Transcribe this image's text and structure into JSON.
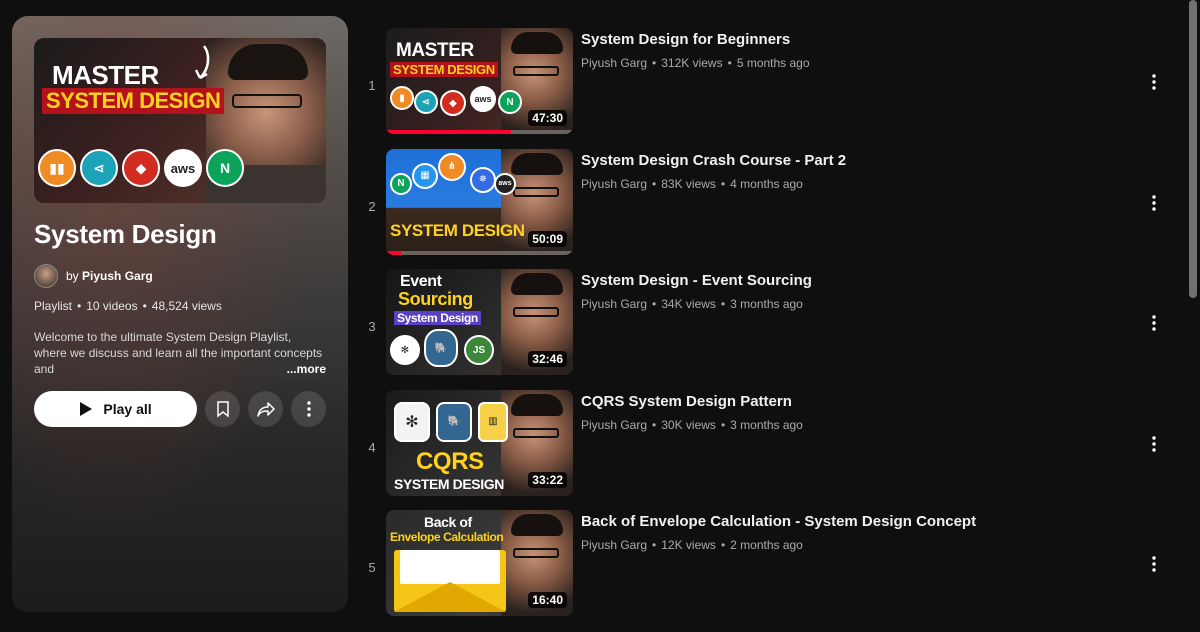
{
  "playlist": {
    "title": "System Design",
    "owner_prefix": "by",
    "owner_name": "Piyush Garg",
    "type_label": "Playlist",
    "video_count": "10 videos",
    "views": "48,524 views",
    "description": "Welcome to the ultimate System Design Playlist, where we discuss and learn all the important concepts and",
    "more_label": "...more",
    "play_all_label": "Play all",
    "hero_thumb": {
      "line1": "MASTER",
      "line2": "SYSTEM DESIGN",
      "logos": [
        "aws",
        "N"
      ]
    }
  },
  "videos": [
    {
      "index": "1",
      "title": "System Design for Beginners",
      "channel": "Piyush Garg",
      "views": "312K views",
      "age": "5 months ago",
      "duration": "47:30",
      "progress": 0.67,
      "thumb_text": [
        "MASTER",
        "SYSTEM DESIGN"
      ],
      "thumb_bg": "#2a1a1a"
    },
    {
      "index": "2",
      "title": "System Design Crash Course - Part 2",
      "channel": "Piyush Garg",
      "views": "83K views",
      "age": "4 months ago",
      "duration": "50:09",
      "progress": 0.08,
      "thumb_text": [
        "SYSTEM DESIGN"
      ],
      "thumb_bg": "#1d6ed1"
    },
    {
      "index": "3",
      "title": "System Design - Event Sourcing",
      "channel": "Piyush Garg",
      "views": "34K views",
      "age": "3 months ago",
      "duration": "32:46",
      "progress": 0,
      "thumb_text": [
        "Event",
        "Sourcing",
        "System Design"
      ],
      "thumb_bg": "#1a1a1a"
    },
    {
      "index": "4",
      "title": "CQRS System Design Pattern",
      "channel": "Piyush Garg",
      "views": "30K views",
      "age": "3 months ago",
      "duration": "33:22",
      "progress": 0,
      "thumb_text": [
        "CQRS",
        "SYSTEM DESIGN"
      ],
      "thumb_bg": "#202020"
    },
    {
      "index": "5",
      "title": "Back of Envelope Calculation - System Design Concept",
      "channel": "Piyush Garg",
      "views": "12K views",
      "age": "2 months ago",
      "duration": "16:40",
      "progress": 0,
      "thumb_text": [
        "Back of",
        "Envelope Calculation"
      ],
      "thumb_bg": "#1a1a1a"
    }
  ],
  "colors": {
    "accent_red": "#ff0033",
    "thumb_yellow": "#ffd21f",
    "page_bg": "#0f0f0f"
  },
  "icons": {
    "play": "play-icon",
    "save": "bookmark-icon",
    "share": "share-icon",
    "more": "more-vertical-icon"
  }
}
